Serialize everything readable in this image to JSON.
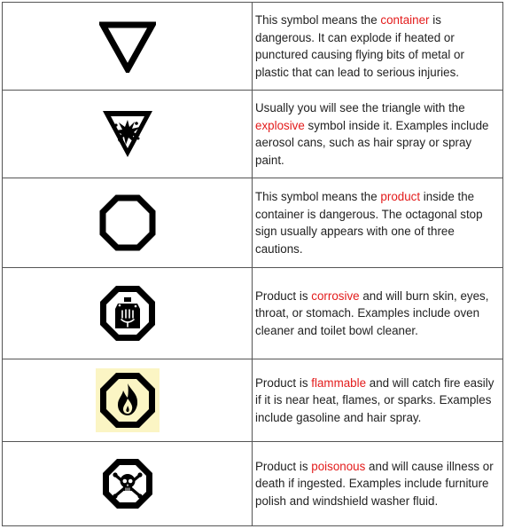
{
  "rows": [
    {
      "icon": "hazard-triangle-icon",
      "before": "This symbol means the ",
      "highlight": "container",
      "after": " is dangerous. It can explode if heated or punctured causing flying bits of metal or plastic that can lead to serious injuries."
    },
    {
      "icon": "explosive-triangle-icon",
      "before": "Usually you will see the triangle with the ",
      "highlight": "explosive",
      "after": " symbol inside it. Examples include aerosol cans, such as hair spray or spray paint."
    },
    {
      "icon": "octagon-icon",
      "before": "This symbol means the ",
      "highlight": "product",
      "after": " inside the container is dangerous. The octagonal stop sign usually appears with one of three cautions."
    },
    {
      "icon": "corrosive-octagon-icon",
      "before": "Product is ",
      "highlight": "corrosive",
      "after": " and will burn skin, eyes, throat, or stomach. Examples include oven cleaner and toilet bowl cleaner."
    },
    {
      "icon": "flammable-octagon-icon",
      "before": "Product is ",
      "highlight": "flammable",
      "after": " and will catch fire easily if it is near heat, flames, or sparks. Examples include gasoline and hair spray."
    },
    {
      "icon": "poison-octagon-icon",
      "before": "Product is ",
      "highlight": "poisonous",
      "after": " and will cause illness or death if ingested. Examples include furniture polish and windshield washer fluid."
    }
  ],
  "colors": {
    "highlight": "#e31b1b",
    "icon_fill": "#000000",
    "flammable_background": "#fbf5c4"
  }
}
